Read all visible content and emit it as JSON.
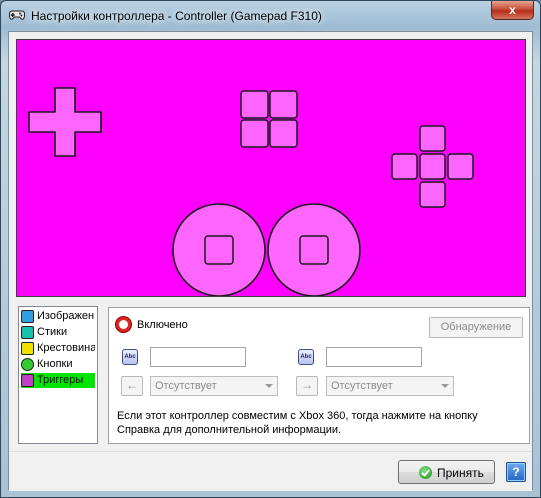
{
  "window": {
    "title": "Настройки контроллера - Controller (Gamepad F310)",
    "close_glyph": "x",
    "app_icon": "gamepad-icon"
  },
  "canvas": {
    "background": "#ff00ff",
    "control_fill": "#ff66ff",
    "outline": "#1a1a1a"
  },
  "sidebar": {
    "items": [
      {
        "label": "Изображен",
        "icon": "image-icon",
        "icon_color": "#2f9fe0",
        "selected": false
      },
      {
        "label": "Стики",
        "icon": "stick-icon",
        "icon_color": "#18c0b0",
        "selected": false
      },
      {
        "label": "Крестовина",
        "icon": "dpad-icon",
        "icon_color": "#f0e000",
        "selected": false
      },
      {
        "label": "Кнопки",
        "icon": "button-icon",
        "icon_color": "#33cc33",
        "selected": false
      },
      {
        "label": "Триггеры",
        "icon": "trigger-icon",
        "icon_color": "#c040c0",
        "selected": true
      }
    ],
    "selected_color": "#00e400"
  },
  "panel": {
    "enabled_label": "Включено",
    "detect_label": "Обнаружение",
    "left_abc": "Abc",
    "right_abc": "Abc",
    "left_field_value": "",
    "right_field_value": "",
    "left_arrow": "←",
    "right_arrow": "→",
    "left_combo_value": "Отсутствует",
    "right_combo_value": "Отсутствует",
    "info_line1": "Если этот контроллер совместим с Xbox 360, тогда нажмите на кнопку",
    "info_line2": "Справка для дополнительной информации."
  },
  "footer": {
    "accept_label": "Принять",
    "help_label": "?"
  }
}
